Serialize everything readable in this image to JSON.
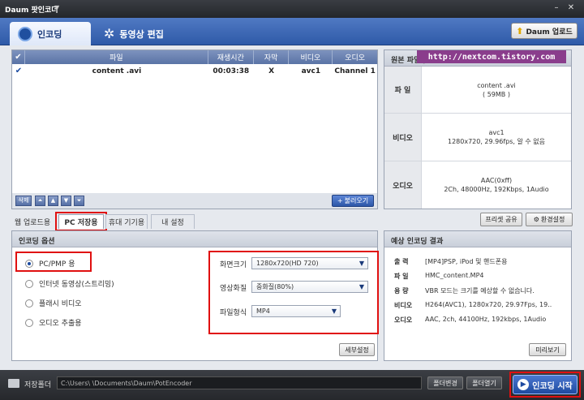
{
  "app": {
    "title": "Daum 팟인코더"
  },
  "header": {
    "tabs": [
      {
        "label": "인코딩"
      },
      {
        "label": "동영상 편집"
      }
    ],
    "update_label": "Daum 업로드"
  },
  "file_list": {
    "columns": [
      "파일",
      "재생시간",
      "자막",
      "비디오",
      "오디오"
    ],
    "rows": [
      {
        "file": "content .avi",
        "duration": "00:03:38",
        "subtitle": "X",
        "video": "avc1",
        "audio": "Channel 1"
      }
    ],
    "delete_label": "삭제",
    "add_label": "불러오기"
  },
  "origin": {
    "title": "원본 파일정보",
    "watermark": "http://nextcom.tistory.com",
    "file": {
      "label": "파 일",
      "line1": "content .avi",
      "line2": "( 59MB )"
    },
    "video": {
      "label": "비디오",
      "line1": "avc1",
      "line2": "1280x720, 29.96fps, 알 수 없음"
    },
    "audio": {
      "label": "오디오",
      "line1": "AAC(0xff)",
      "line2": "2Ch, 48000Hz, 192Kbps, 1Audio"
    }
  },
  "option_tabs": [
    "웹 업로드용",
    "PC 저장용",
    "휴대 기기용",
    "내 설정"
  ],
  "preset_share_label": "프리셋 공유",
  "env_settings_label": "환경설정",
  "encoding_options": {
    "title": "인코딩 옵션",
    "radios": [
      "PC/PMP 용",
      "인터넷 동영상(스트리밍)",
      "플래시 비디오",
      "오디오 추출용"
    ],
    "fields": {
      "resolution_label": "화면크기",
      "resolution_value": "1280x720(HD 720)",
      "quality_label": "영상화질",
      "quality_value": "중화질(80%)",
      "format_label": "파일형식",
      "format_value": "MP4"
    },
    "detail_label": "세부설정"
  },
  "result": {
    "title": "예상 인코딩 결과",
    "rows": [
      {
        "key": "출 력",
        "value": "[MP4]PSP, iPod 및 핸드폰용"
      },
      {
        "key": "파 일",
        "value": "HMC_content.MP4"
      },
      {
        "key": "용 량",
        "value": "VBR 모드는 크기를 예상할 수 없습니다."
      },
      {
        "key": "비디오",
        "value": "H264(AVC1), 1280x720, 29.97Fps, 19.."
      },
      {
        "key": "오디오",
        "value": "AAC, 2ch, 44100Hz, 192kbps, 1Audio"
      }
    ],
    "preview_label": "미리보기"
  },
  "bottom": {
    "save_folder_label": "저장폴더",
    "path": "C:\\Users\\       \\Documents\\Daum\\PotEncoder",
    "change_folder_label": "폴더변경",
    "open_folder_label": "폴더열기",
    "start_label": "인코딩 시작"
  }
}
